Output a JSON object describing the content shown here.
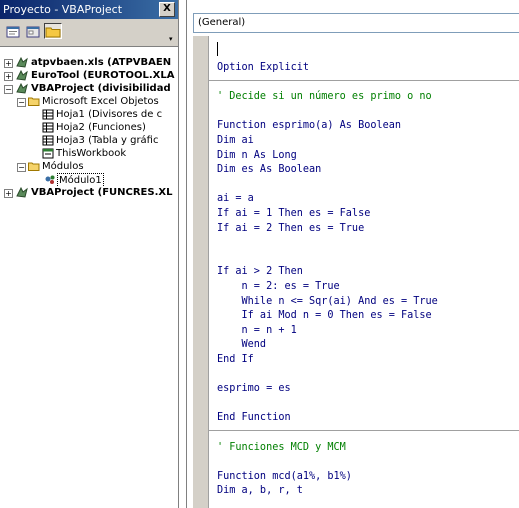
{
  "project": {
    "title": "Proyecto - VBAProject",
    "close_label": "X",
    "toolbar": {
      "buttons": [
        {
          "name": "view-code-button",
          "icon": "code-view-icon"
        },
        {
          "name": "view-object-button",
          "icon": "form-view-icon"
        },
        {
          "name": "toggle-folders-button",
          "icon": "folder-icon"
        }
      ]
    },
    "tree": [
      {
        "label": "atpvbaen.xls (ATPVBAEN",
        "bold": true,
        "expander": "+",
        "icon": "vba-project-icon"
      },
      {
        "label": "EuroTool (EUROTOOL.XLA",
        "bold": true,
        "expander": "+",
        "icon": "vba-project-icon"
      },
      {
        "label": "VBAProject (divisibilidad",
        "bold": true,
        "expander": "-",
        "icon": "vba-project-icon"
      },
      {
        "label": "Microsoft Excel Objetos",
        "bold": false,
        "expander": "-",
        "icon": "folder-open-icon"
      },
      {
        "label": "Hoja1 (Divisores de c",
        "bold": false,
        "expander": "",
        "icon": "sheet-icon"
      },
      {
        "label": "Hoja2 (Funciones)",
        "bold": false,
        "expander": "",
        "icon": "sheet-icon"
      },
      {
        "label": "Hoja3 (Tabla y gráfic",
        "bold": false,
        "expander": "",
        "icon": "sheet-icon"
      },
      {
        "label": "ThisWorkbook",
        "bold": false,
        "expander": "",
        "icon": "workbook-icon"
      },
      {
        "label": "Módulos",
        "bold": false,
        "expander": "-",
        "icon": "folder-open-icon"
      },
      {
        "label": "Módulo1",
        "bold": false,
        "expander": "",
        "icon": "module-icon",
        "selected": true
      },
      {
        "label": "VBAProject (FUNCRES.XL",
        "bold": true,
        "expander": "+",
        "icon": "vba-project-icon"
      }
    ]
  },
  "code_window": {
    "object_combo": "(General)",
    "lines": [
      "Option Explicit",
      "",
      "' Decide si un número es primo o no",
      "",
      "Function esprimo(a) As Boolean",
      "Dim ai",
      "Dim n As Long",
      "Dim es As Boolean",
      "",
      "ai = a",
      "If ai = 1 Then es = False",
      "If ai = 2 Then es = True",
      "",
      "",
      "If ai > 2 Then",
      "    n = 2: es = True",
      "    While n <= Sqr(ai) And es = True",
      "    If ai Mod n = 0 Then es = False",
      "    n = n + 1",
      "    Wend",
      "End If",
      "",
      "esprimo = es",
      "",
      "End Function",
      "",
      "' Funciones MCD y MCM",
      "",
      "Function mcd(a1%, b1%)",
      "Dim a, b, r, t"
    ],
    "colors": {
      "keyword": "#00007f",
      "comment": "#007f00"
    }
  }
}
